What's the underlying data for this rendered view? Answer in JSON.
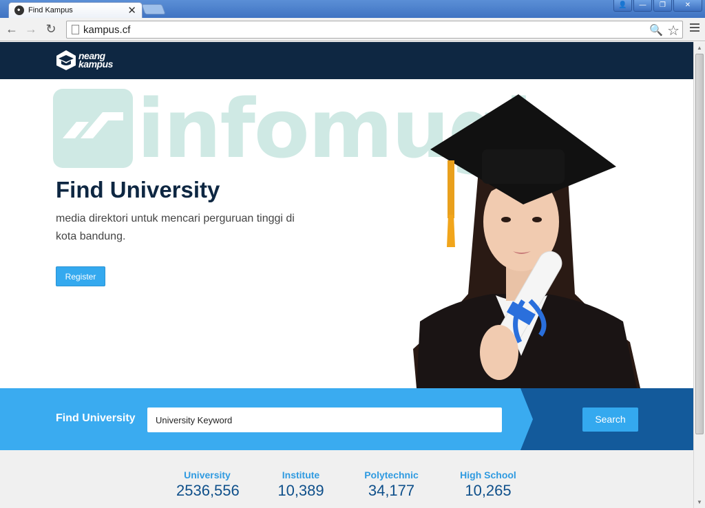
{
  "browser": {
    "tab_title": "Find Kampus",
    "tab_close": "✕",
    "url": "kampus.cf",
    "window_buttons": {
      "user": "👤",
      "minimize": "—",
      "restore": "❐",
      "close": "✕"
    },
    "nav": {
      "back": "←",
      "forward": "→",
      "reload": "↻"
    },
    "zoom_glyph": "🔍",
    "star_glyph": "☆"
  },
  "site": {
    "logo_text_line1": "neang",
    "logo_text_line2": "kampus",
    "watermark_text": "infomugi",
    "hero": {
      "title": "Find University",
      "subtitle": "media direktori untuk mencari perguruan tinggi di kota bandung.",
      "register_label": "Register"
    },
    "search": {
      "label": "Find University",
      "input_value": "University Keyword",
      "button_label": "Search"
    },
    "stats": [
      {
        "label": "University",
        "value": "2536,556"
      },
      {
        "label": "Institute",
        "value": "10,389"
      },
      {
        "label": "Polytechnic",
        "value": "34,177"
      },
      {
        "label": "High School",
        "value": "10,265"
      }
    ]
  },
  "colors": {
    "header_navy": "#0e2742",
    "accent_blue": "#34a9ef",
    "band_blue": "#3aabf0",
    "band_dark": "#135a9b",
    "watermark_mint": "#cfe9e4"
  }
}
